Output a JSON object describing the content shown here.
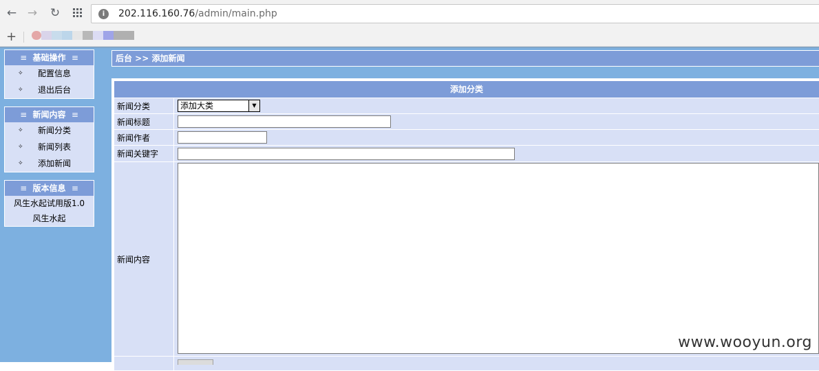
{
  "browser": {
    "url_host": "202.116.160.76",
    "url_path": "/admin/main.php",
    "new_tab_label": "+"
  },
  "sidebar": {
    "sections": [
      {
        "title": "基础操作",
        "items": [
          "配置信息",
          "退出后台"
        ]
      },
      {
        "title": "新闻内容",
        "items": [
          "新闻分类",
          "新闻列表",
          "添加新闻"
        ]
      },
      {
        "title": "版本信息",
        "lines": [
          "风生水起试用版1.0",
          "风生水起"
        ]
      }
    ]
  },
  "breadcrumb": "后台 >> 添加新闻",
  "form": {
    "title": "添加分类",
    "category_label": "新闻分类",
    "category_selected": "添加大类",
    "title_label": "新闻标题",
    "author_label": "新闻作者",
    "keywords_label": "新闻关键字",
    "content_label": "新闻内容"
  },
  "watermark": "www.wooyun.org",
  "colors": {
    "header_blue": "#7d9cd8",
    "panel_bg": "#7db0e0",
    "row_bg": "#d8e0f6"
  }
}
